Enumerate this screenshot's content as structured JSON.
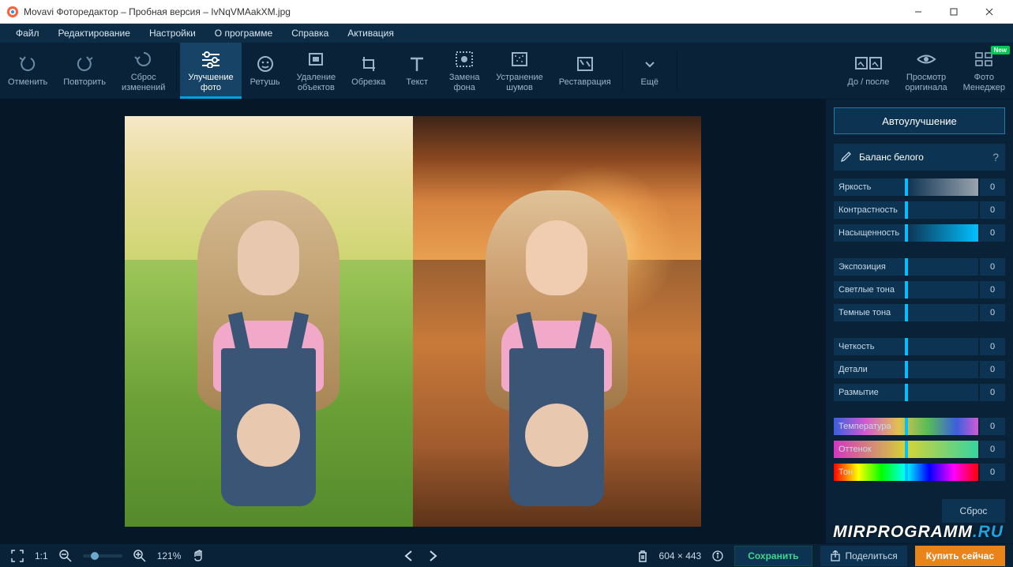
{
  "titlebar": {
    "text": "Movavi Фоторедактор – Пробная версия – IvNqVMAakXM.jpg"
  },
  "menu": [
    "Файл",
    "Редактирование",
    "Настройки",
    "О программе",
    "Справка",
    "Активация"
  ],
  "toolbar": {
    "undo": "Отменить",
    "redo": "Повторить",
    "reset": "Сброс\nизменений",
    "enhance": "Улучшение\nфото",
    "retouch": "Ретушь",
    "remove": "Удаление\nобъектов",
    "crop": "Обрезка",
    "text": "Текст",
    "bg": "Замена\nфона",
    "noise": "Устранение\nшумов",
    "restore": "Реставрация",
    "more": "Ещё",
    "before": "До / после",
    "original": "Просмотр\nоригинала",
    "manager": "Фото\nМенеджер",
    "new_badge": "New"
  },
  "panel": {
    "auto": "Автоулучшение",
    "wb": "Баланс белого",
    "help": "?",
    "reset": "Сброс",
    "sliders1": [
      {
        "label": "Яркость",
        "value": "0",
        "grad": "grad-bright"
      },
      {
        "label": "Контрастность",
        "value": "0",
        "grad": ""
      },
      {
        "label": "Насыщенность",
        "value": "0",
        "grad": "grad-satur"
      }
    ],
    "sliders2": [
      {
        "label": "Экспозиция",
        "value": "0"
      },
      {
        "label": "Светлые тона",
        "value": "0"
      },
      {
        "label": "Темные тона",
        "value": "0"
      }
    ],
    "sliders3": [
      {
        "label": "Четкость",
        "value": "0"
      },
      {
        "label": "Детали",
        "value": "0"
      },
      {
        "label": "Размытие",
        "value": "0"
      }
    ],
    "sliders4": [
      {
        "label": "Температура",
        "value": "0",
        "grad": "grad-temp"
      },
      {
        "label": "Оттенок",
        "value": "0",
        "grad": "grad-tint"
      },
      {
        "label": "Тон",
        "value": "0",
        "grad": "grad-hue"
      }
    ]
  },
  "status": {
    "fit": "1:1",
    "zoom": "121%",
    "dims": "604 × 443",
    "save": "Сохранить",
    "share": "Поделиться",
    "buy": "Купить сейчас"
  },
  "watermark": {
    "a": "MIRPROGRAMM",
    "b": ".RU"
  }
}
